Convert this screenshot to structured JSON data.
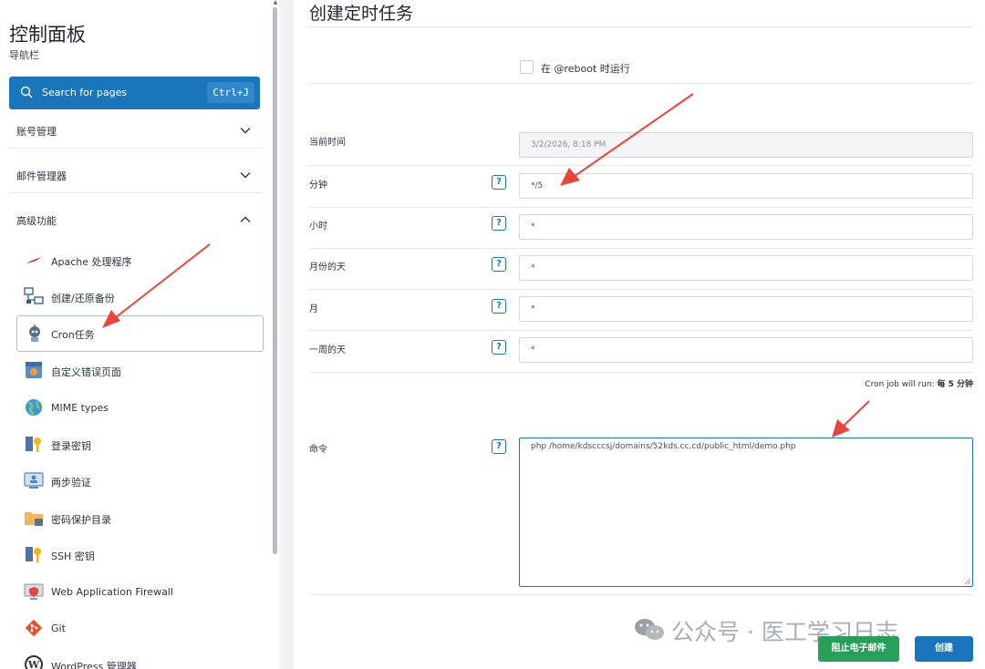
{
  "sidebar": {
    "title": "控制面板",
    "subtitle": "导航栏",
    "search": {
      "label": "Search for pages",
      "shortcut": "Ctrl+J"
    },
    "sections": [
      {
        "label": "账号管理",
        "expanded": false
      },
      {
        "label": "邮件管理器",
        "expanded": false
      },
      {
        "label": "高级功能",
        "expanded": true
      }
    ],
    "items": [
      {
        "label": "Apache 处理程序",
        "icon": "feather-icon"
      },
      {
        "label": "创建/还原备份",
        "icon": "network-backup-icon"
      },
      {
        "label": "Cron任务",
        "icon": "robot-icon",
        "active": true
      },
      {
        "label": "自定义错误页面",
        "icon": "error-page-icon"
      },
      {
        "label": "MIME types",
        "icon": "globe-icon"
      },
      {
        "label": "登录密钥",
        "icon": "key-icon"
      },
      {
        "label": "两步验证",
        "icon": "two-step-icon"
      },
      {
        "label": "密码保护目录",
        "icon": "folder-lock-icon"
      },
      {
        "label": "SSH 密钥",
        "icon": "ssh-key-icon"
      },
      {
        "label": "Web Application Firewall",
        "icon": "firewall-icon"
      },
      {
        "label": "Git",
        "icon": "git-icon"
      },
      {
        "label": "WordPress 管理器",
        "icon": "wordpress-icon"
      }
    ]
  },
  "main": {
    "title": "创建定时任务",
    "reboot_label": "在 @reboot 时运行",
    "current_time": {
      "label": "当前时间",
      "value": "3/2/2026, 8:18 PM"
    },
    "fields": [
      {
        "label": "分钟",
        "value": "*/5"
      },
      {
        "label": "小时",
        "value": "*"
      },
      {
        "label": "月份的天",
        "value": "*"
      },
      {
        "label": "月",
        "value": "*"
      },
      {
        "label": "一周的天",
        "value": "*"
      }
    ],
    "help_label": "?",
    "run_prefix": "Cron job will run: ",
    "run_value": "每 5 分钟",
    "command": {
      "label": "命令",
      "value": "php /home/kdscccsj/domains/52kds.cc.cd/public_html/demo.php"
    },
    "buttons": {
      "block_email": "阻止电子邮件",
      "create": "创建"
    },
    "watermark": "公众号 · 医工学习日志"
  },
  "colors": {
    "accent": "#1b75bb",
    "green": "#27a05a",
    "arrow": "#e8453c"
  }
}
